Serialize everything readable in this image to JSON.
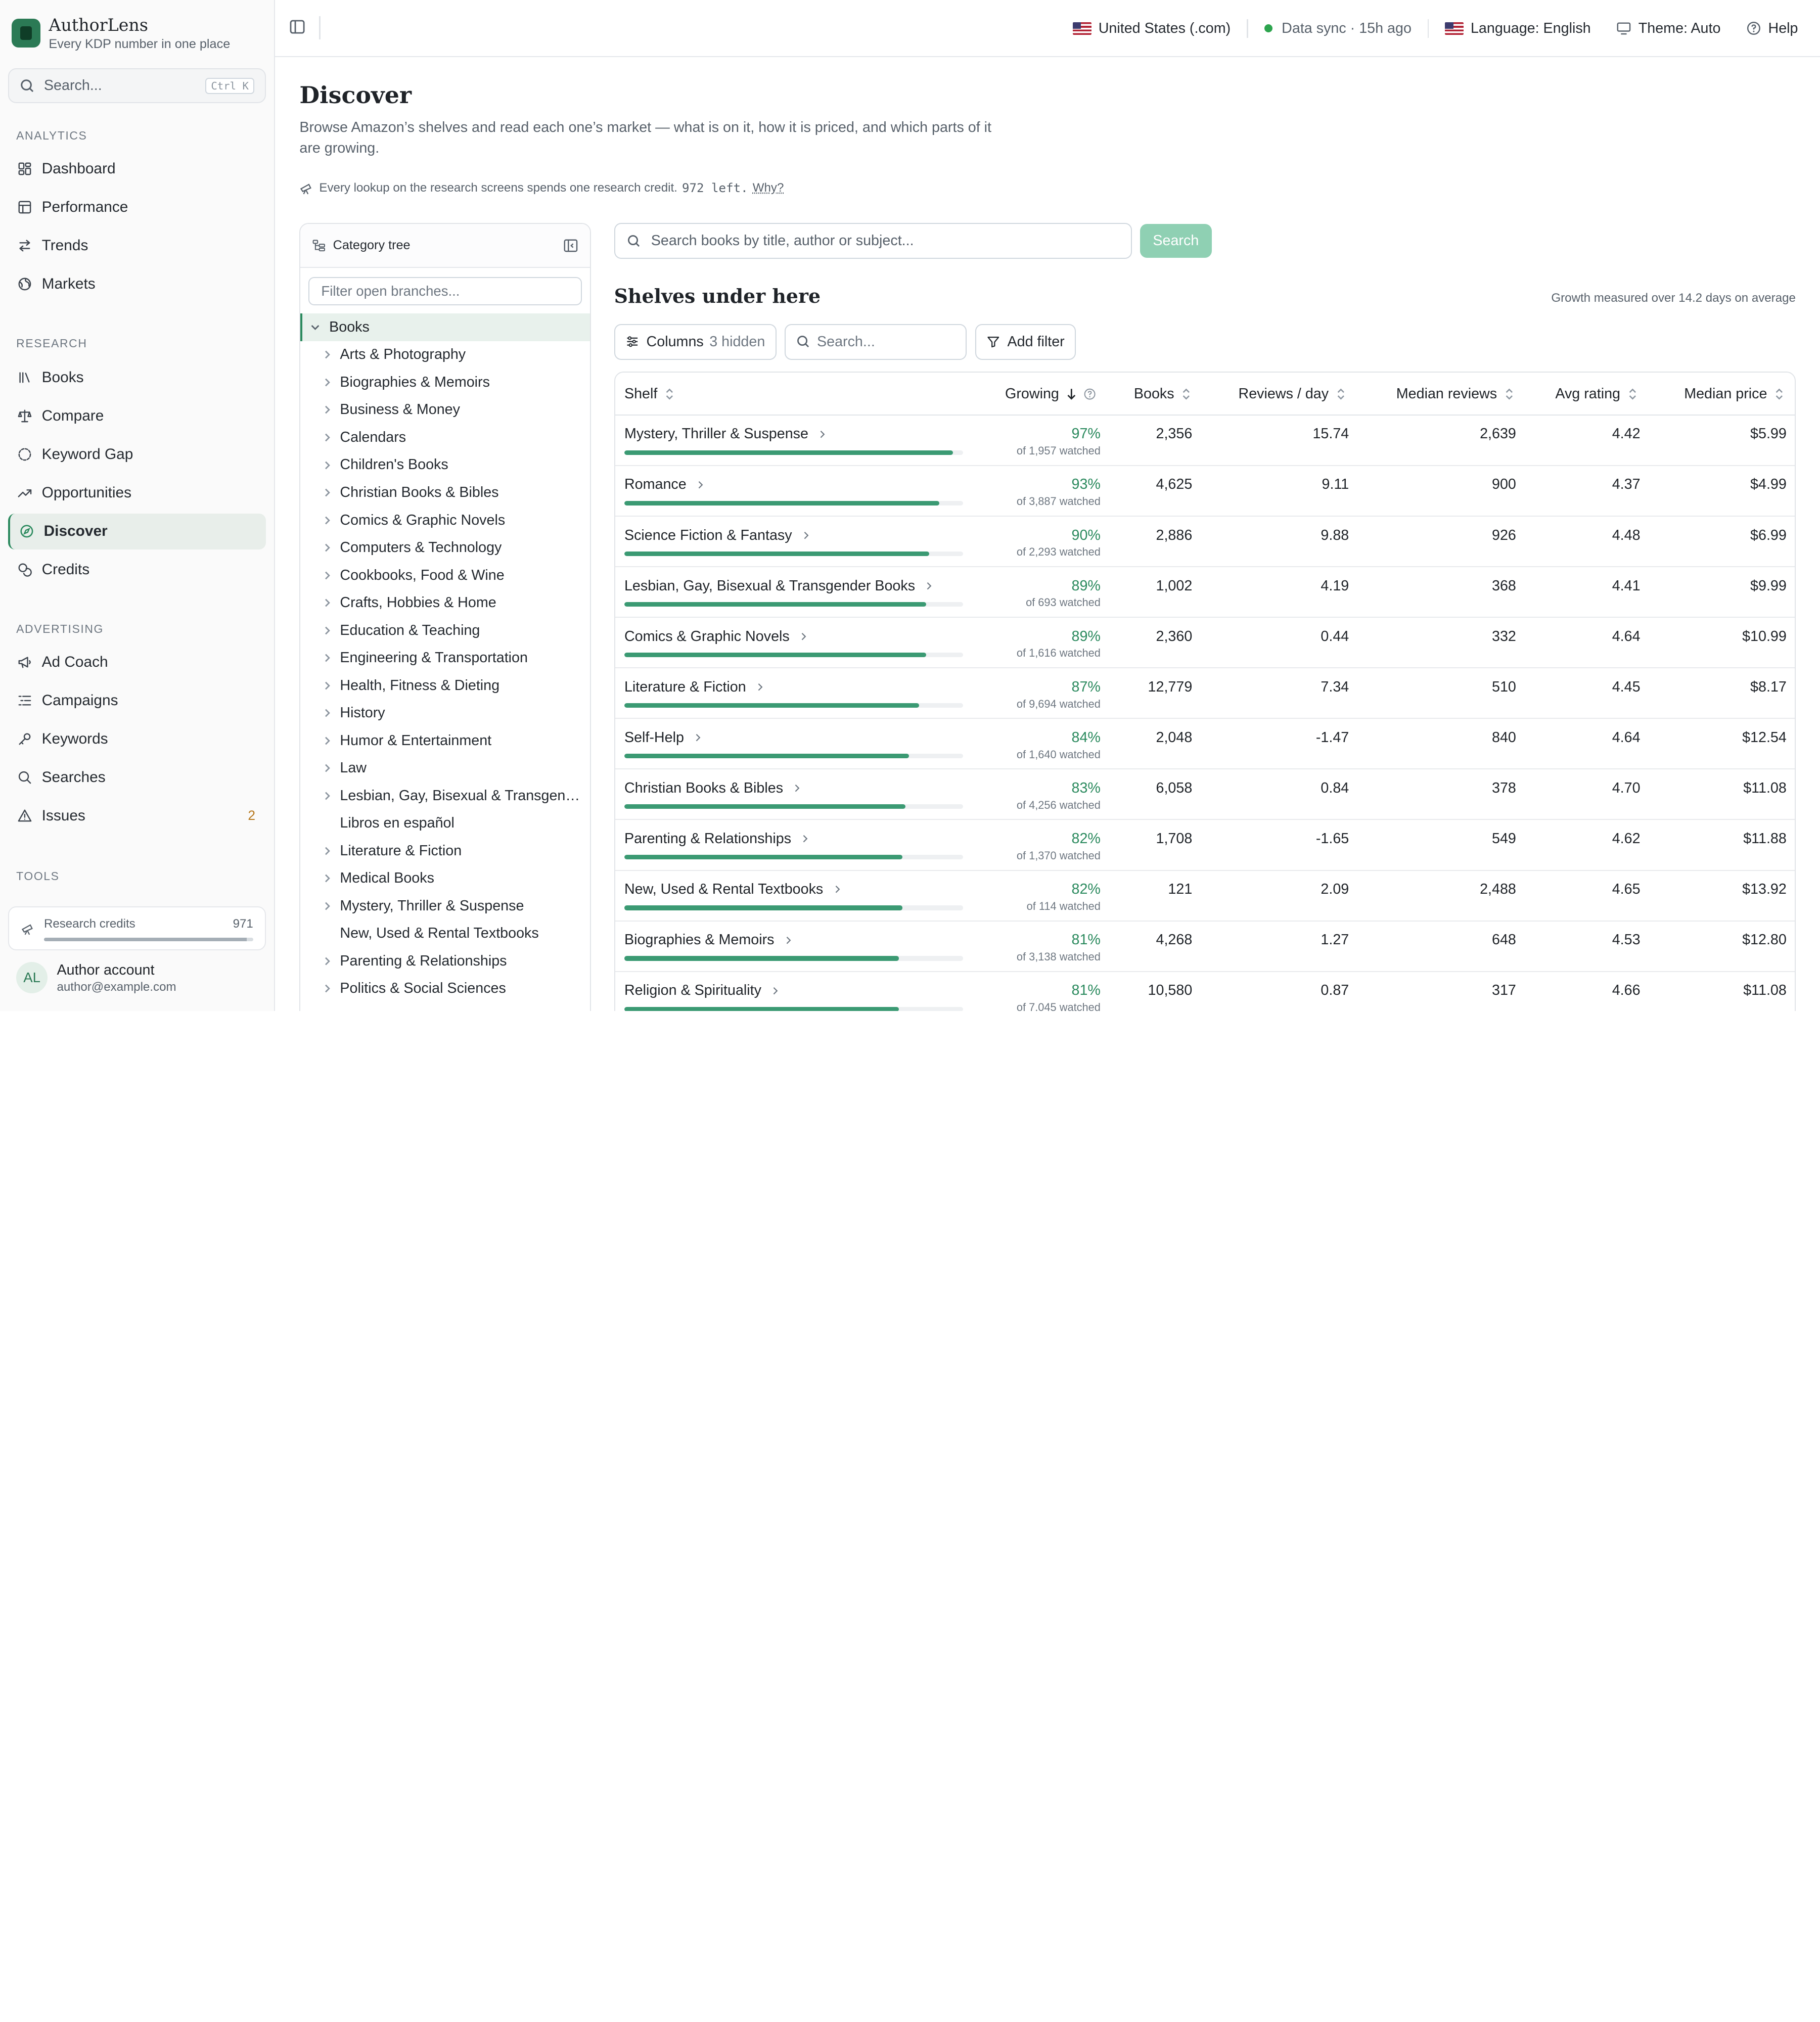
{
  "brand": {
    "name": "AuthorLens",
    "tagline": "Every KDP number in one place"
  },
  "sidebar": {
    "search_placeholder": "Search...",
    "search_shortcut": "Ctrl K",
    "sections": {
      "analytics": "ANALYTICS",
      "research": "RESEARCH",
      "advertising": "ADVERTISING",
      "tools": "TOOLS"
    },
    "analytics_items": [
      {
        "label": "Dashboard",
        "icon": "dashboard-icon"
      },
      {
        "label": "Performance",
        "icon": "table-icon"
      },
      {
        "label": "Trends",
        "icon": "trends-icon"
      },
      {
        "label": "Markets",
        "icon": "globe-icon"
      }
    ],
    "research_items": [
      {
        "label": "Books",
        "icon": "library-icon"
      },
      {
        "label": "Compare",
        "icon": "scale-icon"
      },
      {
        "label": "Keyword Gap",
        "icon": "gap-icon"
      },
      {
        "label": "Opportunities",
        "icon": "trending-up-icon"
      },
      {
        "label": "Discover",
        "icon": "compass-icon",
        "active": true
      },
      {
        "label": "Credits",
        "icon": "coins-icon"
      }
    ],
    "advertising_items": [
      {
        "label": "Ad Coach",
        "icon": "megaphone-icon"
      },
      {
        "label": "Campaigns",
        "icon": "list-icon"
      },
      {
        "label": "Keywords",
        "icon": "key-icon"
      },
      {
        "label": "Searches",
        "icon": "search-icon"
      },
      {
        "label": "Issues",
        "icon": "warning-icon",
        "badge": "2"
      }
    ],
    "credits_card": {
      "label": "Research credits",
      "value": "971",
      "fraction": 0.97
    },
    "account": {
      "initials": "AL",
      "name": "Author account",
      "email": "author@example.com"
    }
  },
  "topbar": {
    "marketplace": "United States (.com)",
    "sync": "Data sync · 15h ago",
    "language": "Language: English",
    "theme": "Theme: Auto",
    "help": "Help"
  },
  "page": {
    "title": "Discover",
    "description": "Browse Amazon’s shelves and read each one’s market — what is on it, how it is priced, and which parts of it are growing.",
    "credit_note": "Every lookup on the research screens spends one research credit.",
    "credits_left": "972 left.",
    "why": "Why?"
  },
  "tree": {
    "title": "Category tree",
    "filter_placeholder": "Filter open branches...",
    "root": "Books",
    "items": [
      {
        "label": "Arts & Photography",
        "chev": true
      },
      {
        "label": "Biographies & Memoirs",
        "chev": true
      },
      {
        "label": "Business & Money",
        "chev": true
      },
      {
        "label": "Calendars",
        "chev": true
      },
      {
        "label": "Children's Books",
        "chev": true
      },
      {
        "label": "Christian Books & Bibles",
        "chev": true
      },
      {
        "label": "Comics & Graphic Novels",
        "chev": true
      },
      {
        "label": "Computers & Technology",
        "chev": true
      },
      {
        "label": "Cookbooks, Food & Wine",
        "chev": true
      },
      {
        "label": "Crafts, Hobbies & Home",
        "chev": true
      },
      {
        "label": "Education & Teaching",
        "chev": true
      },
      {
        "label": "Engineering & Transportation",
        "chev": true
      },
      {
        "label": "Health, Fitness & Dieting",
        "chev": true
      },
      {
        "label": "History",
        "chev": true
      },
      {
        "label": "Humor & Entertainment",
        "chev": true
      },
      {
        "label": "Law",
        "chev": true
      },
      {
        "label": "Lesbian, Gay, Bisexual & Transgende...",
        "chev": true
      },
      {
        "label": "Libros en español",
        "chev": false
      },
      {
        "label": "Literature & Fiction",
        "chev": true
      },
      {
        "label": "Medical Books",
        "chev": true
      },
      {
        "label": "Mystery, Thriller & Suspense",
        "chev": true
      },
      {
        "label": "New, Used & Rental Textbooks",
        "chev": false
      },
      {
        "label": "Parenting & Relationships",
        "chev": true
      },
      {
        "label": "Politics & Social Sciences",
        "chev": true
      }
    ]
  },
  "search": {
    "placeholder": "Search books by title, author or subject...",
    "button": "Search"
  },
  "shelves": {
    "title": "Shelves under here",
    "growth_note": "Growth measured over 14.2 days on average",
    "columns_button": "Columns",
    "columns_hidden": "3 hidden",
    "search_placeholder": "Search...",
    "add_filter": "Add filter",
    "headers": {
      "shelf": "Shelf",
      "growing": "Growing",
      "books": "Books",
      "reviews_day": "Reviews / day",
      "median_reviews": "Median reviews",
      "avg_rating": "Avg rating",
      "median_price": "Median price"
    },
    "rows": [
      {
        "shelf": "Mystery, Thriller & Suspense",
        "growing": "97%",
        "growing_value": 0.97,
        "watched": "of 1,957 watched",
        "books": "2,356",
        "reviews_day": "15.74",
        "median_reviews": "2,639",
        "avg_rating": "4.42",
        "median_price": "$5.99"
      },
      {
        "shelf": "Romance",
        "growing": "93%",
        "growing_value": 0.93,
        "watched": "of 3,887 watched",
        "books": "4,625",
        "reviews_day": "9.11",
        "median_reviews": "900",
        "avg_rating": "4.37",
        "median_price": "$4.99"
      },
      {
        "shelf": "Science Fiction & Fantasy",
        "growing": "90%",
        "growing_value": 0.9,
        "watched": "of 2,293 watched",
        "books": "2,886",
        "reviews_day": "9.88",
        "median_reviews": "926",
        "avg_rating": "4.48",
        "median_price": "$6.99"
      },
      {
        "shelf": "Lesbian, Gay, Bisexual & Transgender Books",
        "growing": "89%",
        "growing_value": 0.89,
        "watched": "of 693 watched",
        "books": "1,002",
        "reviews_day": "4.19",
        "median_reviews": "368",
        "avg_rating": "4.41",
        "median_price": "$9.99"
      },
      {
        "shelf": "Comics & Graphic Novels",
        "growing": "89%",
        "growing_value": 0.89,
        "watched": "of 1,616 watched",
        "books": "2,360",
        "reviews_day": "0.44",
        "median_reviews": "332",
        "avg_rating": "4.64",
        "median_price": "$10.99"
      },
      {
        "shelf": "Literature & Fiction",
        "growing": "87%",
        "growing_value": 0.87,
        "watched": "of 9,694 watched",
        "books": "12,779",
        "reviews_day": "7.34",
        "median_reviews": "510",
        "avg_rating": "4.45",
        "median_price": "$8.17"
      },
      {
        "shelf": "Self-Help",
        "growing": "84%",
        "growing_value": 0.84,
        "watched": "of 1,640 watched",
        "books": "2,048",
        "reviews_day": "-1.47",
        "median_reviews": "840",
        "avg_rating": "4.64",
        "median_price": "$12.54"
      },
      {
        "shelf": "Christian Books & Bibles",
        "growing": "83%",
        "growing_value": 0.83,
        "watched": "of 4,256 watched",
        "books": "6,058",
        "reviews_day": "0.84",
        "median_reviews": "378",
        "avg_rating": "4.70",
        "median_price": "$11.08"
      },
      {
        "shelf": "Parenting & Relationships",
        "growing": "82%",
        "growing_value": 0.82,
        "watched": "of 1,370 watched",
        "books": "1,708",
        "reviews_day": "-1.65",
        "median_reviews": "549",
        "avg_rating": "4.62",
        "median_price": "$11.88"
      },
      {
        "shelf": "New, Used & Rental Textbooks",
        "growing": "82%",
        "growing_value": 0.82,
        "watched": "of 114 watched",
        "books": "121",
        "reviews_day": "2.09",
        "median_reviews": "2,488",
        "avg_rating": "4.65",
        "median_price": "$13.92"
      },
      {
        "shelf": "Biographies & Memoirs",
        "growing": "81%",
        "growing_value": 0.81,
        "watched": "of 3,138 watched",
        "books": "4,268",
        "reviews_day": "1.27",
        "median_reviews": "648",
        "avg_rating": "4.53",
        "median_price": "$12.80"
      },
      {
        "shelf": "Religion & Spirituality",
        "growing": "81%",
        "growing_value": 0.81,
        "watched": "of 7,045 watched",
        "books": "10,580",
        "reviews_day": "0.87",
        "median_reviews": "317",
        "avg_rating": "4.66",
        "median_price": "$11.08"
      }
    ]
  },
  "colors": {
    "accent": "#2b8a5e",
    "bar": "#3b9a73",
    "badge": "#b7791f"
  }
}
